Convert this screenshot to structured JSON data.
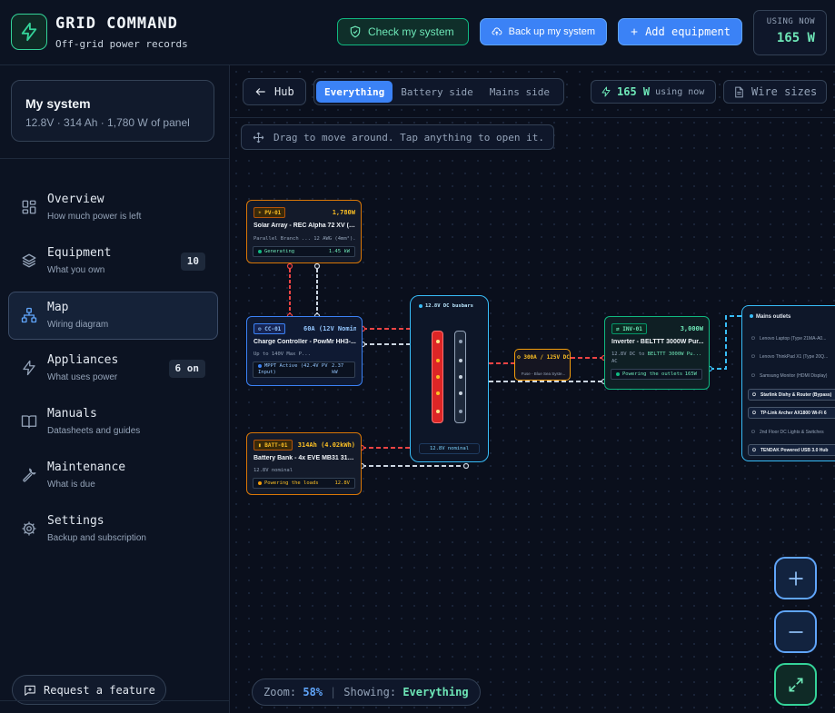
{
  "app": {
    "title": "GRID COMMAND",
    "subtitle": "Off-grid power records"
  },
  "header": {
    "check_label": "Check my system",
    "backup_label": "Back up my system",
    "add_label": "Add equipment",
    "using_label": "USING NOW",
    "using_value": "165 W"
  },
  "system": {
    "name": "My system",
    "specs": "12.8V · 314 Ah · 1,780 W of panel"
  },
  "nav": [
    {
      "title": "Overview",
      "sub": "How much power is left",
      "icon": "grid-icon",
      "badge": ""
    },
    {
      "title": "Equipment",
      "sub": "What you own",
      "icon": "layers-icon",
      "badge": "10"
    },
    {
      "title": "Map",
      "sub": "Wiring diagram",
      "icon": "network-icon",
      "badge": "",
      "active": true
    },
    {
      "title": "Appliances",
      "sub": "What uses power",
      "icon": "bolt-icon",
      "badge": "6 on"
    },
    {
      "title": "Manuals",
      "sub": "Datasheets and guides",
      "icon": "book-icon",
      "badge": ""
    },
    {
      "title": "Maintenance",
      "sub": "What is due",
      "icon": "wrench-icon",
      "badge": ""
    },
    {
      "title": "Settings",
      "sub": "Backup and subscription",
      "icon": "gear-icon",
      "badge": ""
    }
  ],
  "feature_label": "Request a feature",
  "toolbar": {
    "hub_label": "Hub",
    "views": [
      "Everything",
      "Battery side",
      "Mains side"
    ],
    "active_view": "Everything",
    "power_value": "165 W",
    "power_label": "using now",
    "wire_label": "Wire sizes"
  },
  "hint": "Drag to move around. Tap anything to open it.",
  "nodes": {
    "pv": {
      "tag": "PV-01",
      "rating": "1,780W",
      "name": "Solar Array - REC Alpha 72 XV (4...",
      "detail": "Parallel Branch ... 12 AWG (4mm²)...",
      "status": "Generating",
      "status_value": "1.45 kW"
    },
    "cc": {
      "tag": "CC-01",
      "rating": "60A (12V Nomin...",
      "name": "Charge Controller - PowMr HH3-...",
      "detail": "Up to 140V Max P...",
      "status": "MPPT Active (42.4V PV Input)",
      "status_value": "2.37 kW"
    },
    "batt": {
      "tag": "BATT-01",
      "rating": "314Ah (4.02kWh)",
      "name": "Battery Bank - 4x EVE MB31 314...",
      "detail": "12.8V nominal",
      "status": "Powering the loads",
      "status_value": "12.8V"
    },
    "bus": {
      "title": "12.8V DC busbars",
      "foot": "12.8V nominal"
    },
    "fuse": {
      "rating": "300A / 125V DC",
      "sub": "Fuse - Blue Sea Syste..."
    },
    "inv": {
      "tag": "INV-01",
      "rating": "3,000W",
      "name": "Inverter - BELTTT 3000W Pur...",
      "detail": "12.8V DC to",
      "detail_link": "BELTTT 3000W Pu...",
      "detail2": "AC",
      "status": "Powering the outlets",
      "status_value": "165W"
    },
    "mains": {
      "title": "Mains outlets",
      "outlets": [
        {
          "label": "Lenovo Laptop (Type 21MA-A0...",
          "on": false
        },
        {
          "label": "Lenovo ThinkPad X1 (Type 20Q...",
          "on": false
        },
        {
          "label": "Samsung Monitor (HDMI Display)",
          "on": false
        },
        {
          "label": "Starlink Dishy & Router (Bypass)",
          "on": true
        },
        {
          "label": "TP-Link Archer AX1800 Wi-Fi 6",
          "on": true
        },
        {
          "label": "2nd Floor DC Lights & Switches",
          "on": false
        },
        {
          "label": "TENDAK Powered USB 3.0 Hub",
          "on": true
        }
      ]
    }
  },
  "zoom": {
    "label": "Zoom:",
    "value": "58%",
    "showing_label": "Showing:",
    "showing_value": "Everything"
  },
  "colors": {
    "accent": "#3b82f6",
    "green": "#34d399",
    "amber": "#d97706",
    "cyan": "#38bdf8"
  }
}
